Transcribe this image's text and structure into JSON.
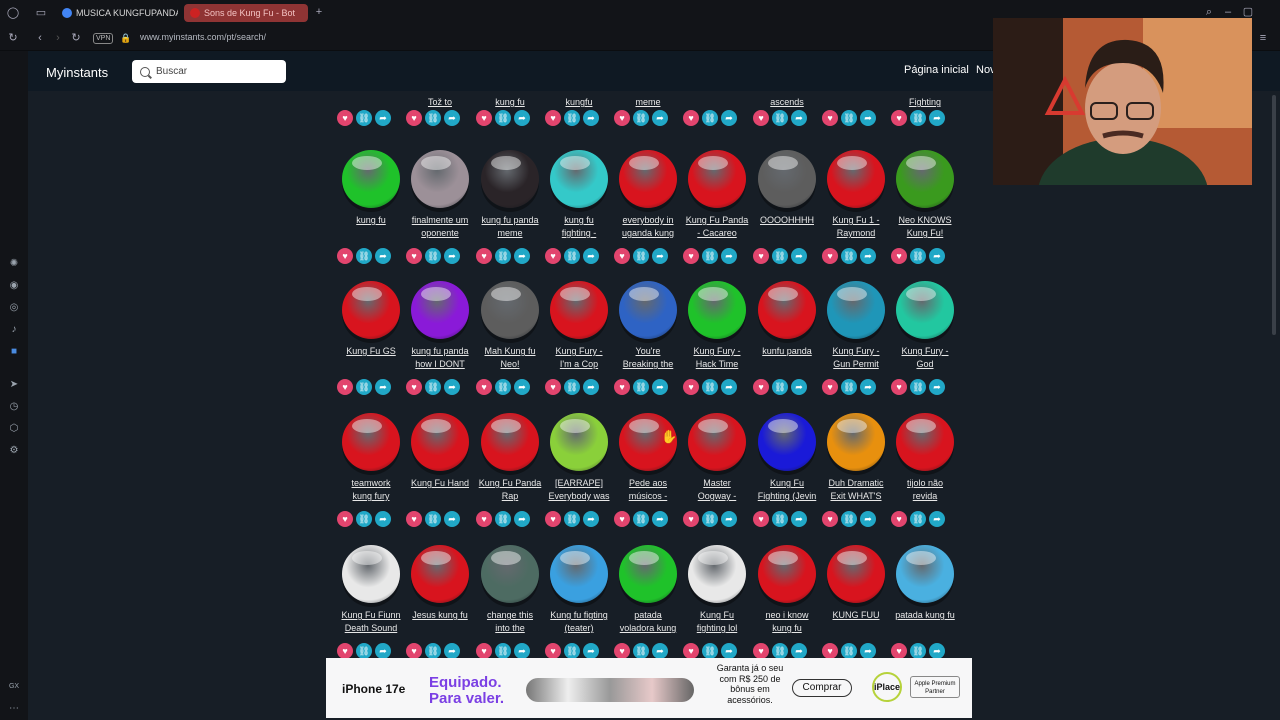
{
  "browser": {
    "tabs": [
      {
        "label": "MUSICA KUNGFUPANDA",
        "favicon_color": "#4285f4"
      },
      {
        "label": "Sons de Kung Fu - Bot",
        "favicon_color": "#cc2222",
        "active": true
      }
    ],
    "vpn_label": "VPN",
    "url": "www.myinstants.com/pt/search/"
  },
  "site": {
    "logo": "Myinstants",
    "search_placeholder": "Buscar",
    "nav": [
      "Página inicial",
      "Nov"
    ]
  },
  "top_row": [
    {
      "name": "Tož to"
    },
    {
      "name": "kung fu"
    },
    {
      "name": "kungfu"
    },
    {
      "name": "meme"
    },
    {
      "name": ""
    },
    {
      "name": "ascends"
    },
    {
      "name": ""
    },
    {
      "name": "Fighting"
    }
  ],
  "sounds": [
    [
      {
        "name": "kung fu",
        "color": "#1fc22a"
      },
      {
        "name": "finalmente um\noponente",
        "color": "#9c9098"
      },
      {
        "name": "kung fu panda\nmeme",
        "color": "#2a2428"
      },
      {
        "name": "kung fu\nfighting -",
        "color": "#34c9c9"
      },
      {
        "name": "everybody in\nuganda kung",
        "color": "#d8141e"
      },
      {
        "name": "Kung Fu Panda\n- Cacareo",
        "color": "#d8141e"
      },
      {
        "name": "OOOOHHHH",
        "color": "#5d5d5d"
      },
      {
        "name": "Kung Fu 1 -\nRaymond",
        "color": "#d8141e"
      },
      {
        "name": "Neo KNOWS\nKung Fu!",
        "color": "#3a9a1e"
      }
    ],
    [
      {
        "name": "Kung Fu GS",
        "color": "#d8141e"
      },
      {
        "name": "kung fu panda\nhow I DONT",
        "color": "#8a1ad8"
      },
      {
        "name": "Mah Kung fu\nNeo!",
        "color": "#5d5d5d"
      },
      {
        "name": "Kung Fury -\nI'm a Cop",
        "color": "#d8141e"
      },
      {
        "name": "You're\nBreaking the",
        "color": "#2e63c4"
      },
      {
        "name": "Kung Fury -\nHack Time",
        "color": "#1fc22a"
      },
      {
        "name": "kunfu panda",
        "color": "#d8141e"
      },
      {
        "name": "Kung Fury -\nGun Permit",
        "color": "#1f96b8"
      },
      {
        "name": "Kung Fury -\nGod",
        "color": "#22c7a0"
      }
    ],
    [
      {
        "name": "teamwork\nkung fury",
        "color": "#d8141e"
      },
      {
        "name": "Kung Fu Hand",
        "color": "#d8141e"
      },
      {
        "name": "Kung Fu Panda\nRap",
        "color": "#d8141e"
      },
      {
        "name": "[EARRAPE]\nEverybody was",
        "color": "#8ad03a"
      },
      {
        "name": "Pede aos\nmúsicos -",
        "color": "#d8141e"
      },
      {
        "name": "Master\nOogway -",
        "color": "#d8141e"
      },
      {
        "name": "Kung Fu\nFighting (Jevin",
        "color": "#1a1ad8"
      },
      {
        "name": "Duh Dramatic\nExit WHAT'S",
        "color": "#e8900e"
      },
      {
        "name": "tijolo não\nrevida",
        "color": "#d8141e"
      }
    ],
    [
      {
        "name": "Kung Fu Fiunn\nDeath Sound",
        "color": "#e8e8e8"
      },
      {
        "name": "Jesus kung fu",
        "color": "#d8141e"
      },
      {
        "name": "change this\ninto the",
        "color": "#4d6b62"
      },
      {
        "name": "Kung fu figting\n(teater)",
        "color": "#3aa0e0"
      },
      {
        "name": "patada\nvoladora kung",
        "color": "#1fc22a"
      },
      {
        "name": "Kung Fu\nfighting lol",
        "color": "#e8e8e8"
      },
      {
        "name": "neo i know\nkung fu",
        "color": "#d8141e"
      },
      {
        "name": "KUNG FUU",
        "color": "#d8141e"
      },
      {
        "name": "patada kung fu",
        "color": "#4ab0e0"
      }
    ]
  ],
  "ad": {
    "brand": "iPhone 17e",
    "headline1": "Equipado.",
    "headline2": "Para valer.",
    "copy": "Garanta já o seu com R$ 250 de bônus em acessórios.",
    "cta": "Comprar",
    "store": "iPlace",
    "partner": "Apple Premium Partner"
  }
}
